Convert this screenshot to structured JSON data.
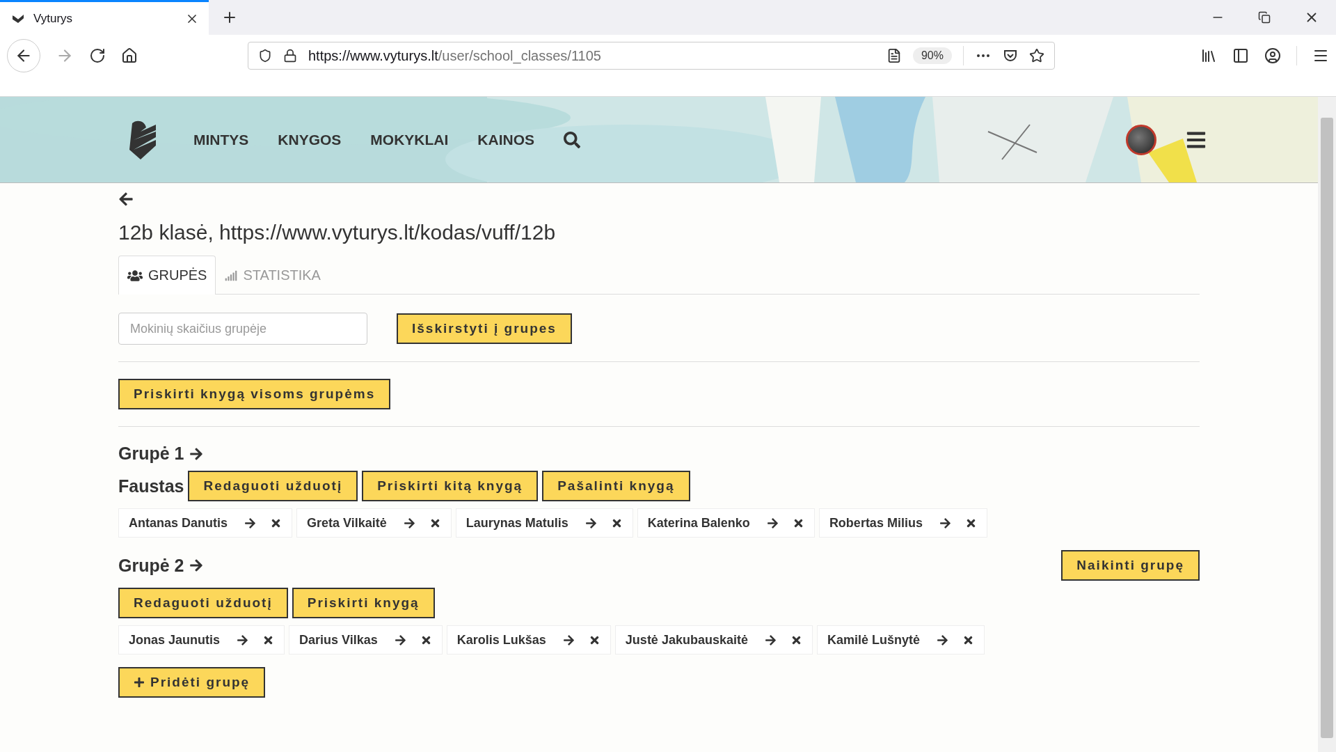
{
  "browser": {
    "tab_title": "Vyturys",
    "url_host": "https://www.vyturys.lt",
    "url_path": "/user/school_classes/1105",
    "zoom": "90%"
  },
  "nav": {
    "items": [
      "MINTYS",
      "KNYGOS",
      "MOKYKLAI",
      "KAINOS"
    ]
  },
  "page": {
    "title": "12b klasė, https://www.vyturys.lt/kodas/vuff/12b",
    "tabs": [
      {
        "label": "GRUPĖS",
        "selected": true
      },
      {
        "label": "STATISTIKA",
        "selected": false
      }
    ],
    "count_field": {
      "placeholder": "Mokinių skaičius grupėje"
    },
    "distribute_button": "Išskirstyti į grupes",
    "assign_all_button": "Priskirti knygą visoms grupėms",
    "groups": [
      {
        "title": "Grupė 1",
        "book": "Faustas",
        "buttons": [
          "Redaguoti užduotį",
          "Priskirti kitą knygą",
          "Pašalinti knygą"
        ],
        "students": [
          "Antanas Danutis",
          "Greta Vilkaitė",
          "Laurynas Matulis",
          "Katerina Balenko",
          "Robertas Milius"
        ]
      },
      {
        "title": "Grupė 2",
        "delete_button": "Naikinti grupę",
        "buttons": [
          "Redaguoti užduotį",
          "Priskirti knygą"
        ],
        "students": [
          "Jonas Jaunutis",
          "Darius Vilkas",
          "Karolis Lukšas",
          "Justė Jakubauskaitė",
          "Kamilė Lušnytė"
        ]
      }
    ],
    "add_group_button": "Pridėti grupę"
  }
}
